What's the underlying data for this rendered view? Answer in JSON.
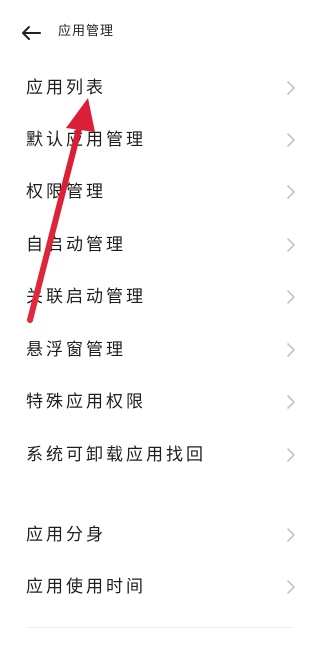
{
  "header": {
    "title": "应用管理",
    "back_icon": "arrow-left-icon"
  },
  "menu_group_1": [
    {
      "label": "应用列表"
    },
    {
      "label": "默认应用管理"
    },
    {
      "label": "权限管理"
    },
    {
      "label": "自启动管理"
    },
    {
      "label": "关联启动管理"
    },
    {
      "label": "悬浮窗管理"
    },
    {
      "label": "特殊应用权限"
    },
    {
      "label": "系统可卸载应用找回"
    }
  ],
  "menu_group_2": [
    {
      "label": "应用分身"
    },
    {
      "label": "应用使用时间"
    }
  ],
  "chevron_icon": "chevron-right-icon",
  "colors": {
    "annotation_arrow": "#e0233a",
    "chevron": "#c4c4c4",
    "text": "#1e1e1e"
  }
}
